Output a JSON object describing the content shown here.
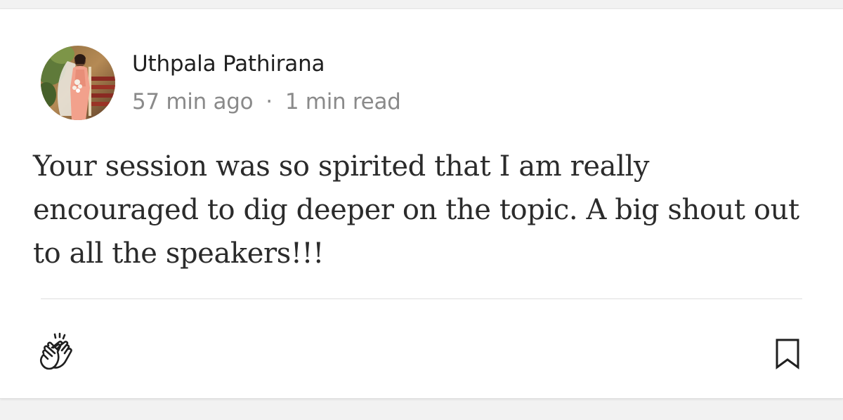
{
  "response": {
    "author": {
      "name": "Uthpala Pathirana",
      "avatar": "profile-photo"
    },
    "meta": {
      "posted": "57 min ago",
      "separator": "·",
      "read_time": "1 min read"
    },
    "body": "Your session was so spirited that I am really encouraged to dig deeper on the topic. A big shout out to all the speakers!!!"
  },
  "actions": {
    "clap_icon": "clap-icon",
    "bookmark_icon": "bookmark-icon"
  },
  "colors": {
    "text_primary": "#1f1f1f",
    "text_secondary": "#8a8a8a",
    "body_text": "#2b2b2b",
    "divider": "#dddddd",
    "page_background": "#f2f2f2",
    "card_background": "#ffffff"
  }
}
